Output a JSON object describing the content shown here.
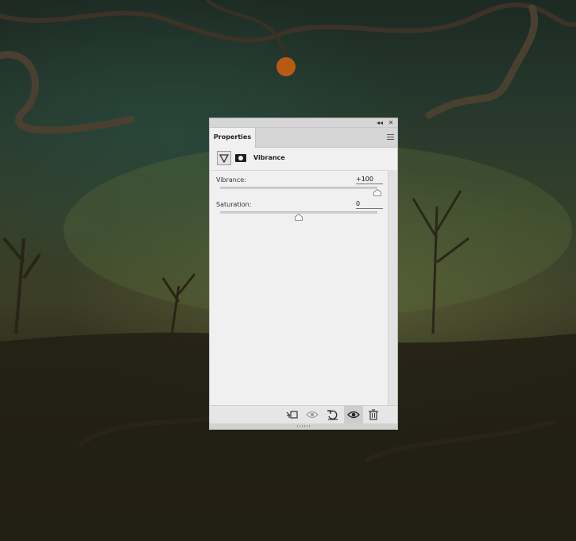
{
  "window": {
    "tab_label": "Properties",
    "collapse_glyph": "◂◂",
    "close_glyph": "✕"
  },
  "adjustment": {
    "title": "Vibrance",
    "icon": "vibrance-triangle-icon",
    "mask_icon": "layer-mask-icon"
  },
  "sliders": [
    {
      "label": "Vibrance:",
      "value": "+100",
      "min": -100,
      "max": 100,
      "current": 100
    },
    {
      "label": "Saturation:",
      "value": "0",
      "min": -100,
      "max": 100,
      "current": 0
    }
  ],
  "bottom_icons": [
    "clip-to-layer-icon",
    "view-previous-state-icon",
    "reset-icon",
    "visibility-eye-icon",
    "trash-icon"
  ],
  "colors": {
    "panel_bg": "#f0f0f0",
    "titlebar": "#d6d6d6",
    "scene_green": "#34402b"
  }
}
